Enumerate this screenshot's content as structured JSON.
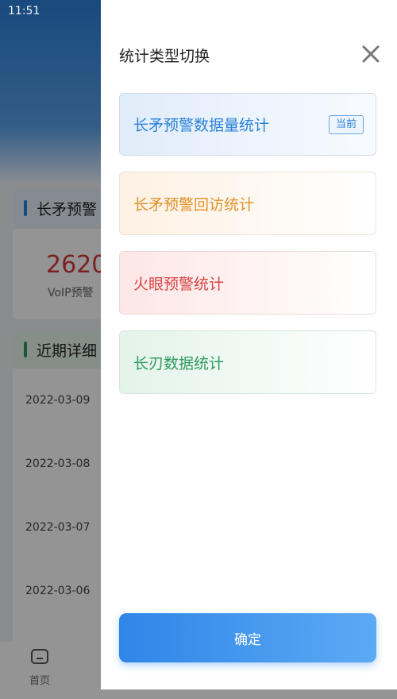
{
  "status_bar": {
    "time": "11:51"
  },
  "background": {
    "card1": {
      "title": "长矛预警",
      "value": "2620",
      "sub": "VoIP预警",
      "accent": "#2a82d8"
    },
    "card2": {
      "title": "近期详细",
      "accent": "#2f9a5e"
    },
    "dates": [
      "2022-03-09",
      "2022-03-08",
      "2022-03-07",
      "2022-03-06"
    ],
    "tabbar": {
      "home_label": "首页"
    }
  },
  "drawer": {
    "title": "统计类型切换",
    "options": [
      {
        "label": "长矛预警数据量统计",
        "badge": "当前",
        "color": "#2a82d8"
      },
      {
        "label": "长矛预警回访统计",
        "color": "#e0922a"
      },
      {
        "label": "火眼预警统计",
        "color": "#d94444"
      },
      {
        "label": "长刃数据统计",
        "color": "#2f9a5e"
      }
    ],
    "confirm_label": "确定"
  }
}
